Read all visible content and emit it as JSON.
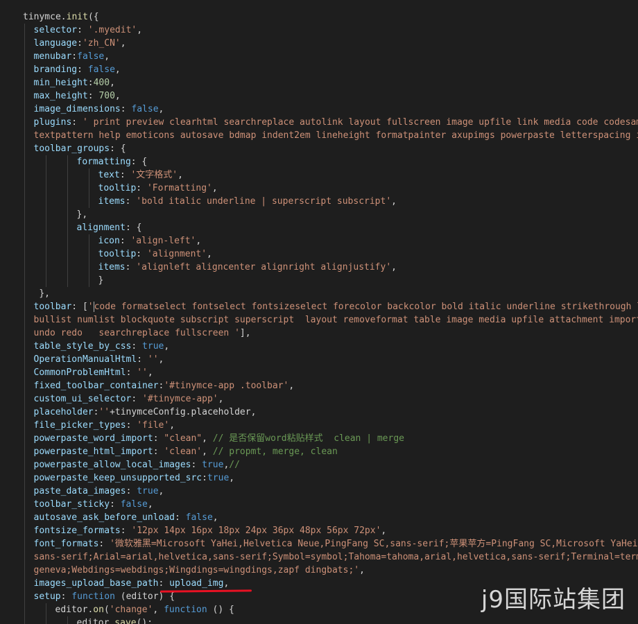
{
  "watermark": "j9国际站集团",
  "colors": {
    "background": "#1e1e1e",
    "property": "#9cdcfe",
    "string": "#ce9178",
    "number": "#b5cea8",
    "keyword": "#569cd6",
    "comment": "#6a9955",
    "function": "#dcdcaa",
    "punctuation": "#d4d4d4",
    "underline": "#e81123"
  },
  "code_lines": [
    {
      "indent": 0,
      "tokens": [
        [
          "w",
          "tinymce"
        ],
        [
          "p",
          "."
        ],
        [
          "f",
          "init"
        ],
        [
          "p",
          "({"
        ]
      ]
    },
    {
      "indent": 1,
      "tokens": [
        [
          "k",
          "selector"
        ],
        [
          "p",
          ": "
        ],
        [
          "s",
          "'.myedit'"
        ],
        [
          "p",
          ","
        ]
      ]
    },
    {
      "indent": 1,
      "tokens": [
        [
          "k",
          "language"
        ],
        [
          "p",
          ":"
        ],
        [
          "s",
          "'zh_CN'"
        ],
        [
          "p",
          ","
        ]
      ]
    },
    {
      "indent": 1,
      "tokens": [
        [
          "k",
          "menubar"
        ],
        [
          "p",
          ":"
        ],
        [
          "b",
          "false"
        ],
        [
          "p",
          ","
        ]
      ]
    },
    {
      "indent": 1,
      "tokens": [
        [
          "k",
          "branding"
        ],
        [
          "p",
          ": "
        ],
        [
          "b",
          "false"
        ],
        [
          "p",
          ","
        ]
      ]
    },
    {
      "indent": 1,
      "tokens": [
        [
          "k",
          "min_height"
        ],
        [
          "p",
          ":"
        ],
        [
          "n",
          "400"
        ],
        [
          "p",
          ","
        ]
      ]
    },
    {
      "indent": 1,
      "tokens": [
        [
          "k",
          "max_height"
        ],
        [
          "p",
          ": "
        ],
        [
          "n",
          "700"
        ],
        [
          "p",
          ","
        ]
      ]
    },
    {
      "indent": 1,
      "tokens": [
        [
          "k",
          "image_dimensions"
        ],
        [
          "p",
          ": "
        ],
        [
          "b",
          "false"
        ],
        [
          "p",
          ","
        ]
      ]
    },
    {
      "indent": 1,
      "tokens": [
        [
          "k",
          "plugins"
        ],
        [
          "p",
          ": "
        ],
        [
          "s",
          "' print preview clearhtml searchreplace autolink layout fullscreen image upfile link media code codesamp"
        ]
      ]
    },
    {
      "indent": 1,
      "tokens": [
        [
          "s",
          "textpattern help emoticons autosave bdmap indent2em lineheight formatpainter axupimgs powerpaste letterspacing ima"
        ]
      ]
    },
    {
      "indent": 1,
      "tokens": [
        [
          "k",
          "toolbar_groups"
        ],
        [
          "p",
          ": {"
        ]
      ]
    },
    {
      "indent": 5,
      "tokens": [
        [
          "k",
          "formatting"
        ],
        [
          "p",
          ": {"
        ]
      ]
    },
    {
      "indent": 7,
      "tokens": [
        [
          "k",
          "text"
        ],
        [
          "p",
          ": "
        ],
        [
          "s",
          "'文字格式'"
        ],
        [
          "p",
          ","
        ]
      ]
    },
    {
      "indent": 7,
      "tokens": [
        [
          "k",
          "tooltip"
        ],
        [
          "p",
          ": "
        ],
        [
          "s",
          "'Formatting'"
        ],
        [
          "p",
          ","
        ]
      ]
    },
    {
      "indent": 7,
      "tokens": [
        [
          "k",
          "items"
        ],
        [
          "p",
          ": "
        ],
        [
          "s",
          "'bold italic underline | superscript subscript'"
        ],
        [
          "p",
          ","
        ]
      ]
    },
    {
      "indent": 5,
      "tokens": [
        [
          "p",
          "},"
        ]
      ]
    },
    {
      "indent": 5,
      "tokens": [
        [
          "k",
          "alignment"
        ],
        [
          "p",
          ": {"
        ]
      ]
    },
    {
      "indent": 7,
      "tokens": [
        [
          "k",
          "icon"
        ],
        [
          "p",
          ": "
        ],
        [
          "s",
          "'align-left'"
        ],
        [
          "p",
          ","
        ]
      ]
    },
    {
      "indent": 7,
      "tokens": [
        [
          "k",
          "tooltip"
        ],
        [
          "p",
          ": "
        ],
        [
          "s",
          "'alignment'"
        ],
        [
          "p",
          ","
        ]
      ]
    },
    {
      "indent": 7,
      "tokens": [
        [
          "k",
          "items"
        ],
        [
          "p",
          ": "
        ],
        [
          "s",
          "'alignleft aligncenter alignright alignjustify'"
        ],
        [
          "p",
          ","
        ]
      ]
    },
    {
      "indent": 7,
      "tokens": [
        [
          "p",
          "}"
        ]
      ]
    },
    {
      "indent": 1,
      "tokens": [
        [
          "p",
          " },"
        ]
      ]
    },
    {
      "indent": 1,
      "tokens": [
        [
          "k",
          "toolbar"
        ],
        [
          "p",
          ": ["
        ],
        [
          "s",
          "'"
        ],
        [
          "cursor",
          ""
        ],
        [
          "s",
          "code formatselect fontselect fontsizeselect forecolor backcolor bold italic underline strikethrough l"
        ]
      ]
    },
    {
      "indent": 1,
      "tokens": [
        [
          "s",
          "bullist numlist blockquote subscript superscript  layout removeformat table image media upfile attachment importw"
        ]
      ]
    },
    {
      "indent": 1,
      "tokens": [
        [
          "s",
          "undo redo   searchreplace fullscreen '"
        ],
        [
          "p",
          "],"
        ]
      ]
    },
    {
      "indent": 1,
      "tokens": [
        [
          "k",
          "table_style_by_css"
        ],
        [
          "p",
          ": "
        ],
        [
          "b",
          "true"
        ],
        [
          "p",
          ","
        ]
      ]
    },
    {
      "indent": 1,
      "tokens": [
        [
          "k",
          "OperationManualHtml"
        ],
        [
          "p",
          ": "
        ],
        [
          "s",
          "''"
        ],
        [
          "p",
          ","
        ]
      ]
    },
    {
      "indent": 1,
      "tokens": [
        [
          "k",
          "CommonProblemHtml"
        ],
        [
          "p",
          ": "
        ],
        [
          "s",
          "''"
        ],
        [
          "p",
          ","
        ]
      ]
    },
    {
      "indent": 1,
      "tokens": [
        [
          "k",
          "fixed_toolbar_container"
        ],
        [
          "p",
          ":"
        ],
        [
          "s",
          "'#tinymce-app .toolbar'"
        ],
        [
          "p",
          ","
        ]
      ]
    },
    {
      "indent": 1,
      "tokens": [
        [
          "k",
          "custom_ui_selector"
        ],
        [
          "p",
          ": "
        ],
        [
          "s",
          "'#tinymce-app'"
        ],
        [
          "p",
          ","
        ]
      ]
    },
    {
      "indent": 1,
      "tokens": [
        [
          "k",
          "placeholder"
        ],
        [
          "p",
          ":"
        ],
        [
          "s",
          "''"
        ],
        [
          "p",
          "+tinymceConfig.placeholder,"
        ]
      ]
    },
    {
      "indent": 1,
      "tokens": [
        [
          "k",
          "file_picker_types"
        ],
        [
          "p",
          ": "
        ],
        [
          "s",
          "'file'"
        ],
        [
          "p",
          ","
        ]
      ]
    },
    {
      "indent": 1,
      "tokens": [
        [
          "k",
          "powerpaste_word_import"
        ],
        [
          "p",
          ": "
        ],
        [
          "s",
          "\"clean\""
        ],
        [
          "p",
          ", "
        ],
        [
          "c",
          "// 是否保留word粘贴样式  clean | merge"
        ]
      ]
    },
    {
      "indent": 1,
      "tokens": [
        [
          "k",
          "powerpaste_html_import"
        ],
        [
          "p",
          ": "
        ],
        [
          "s",
          "'clean'"
        ],
        [
          "p",
          ", "
        ],
        [
          "c",
          "// propmt, merge, clean"
        ]
      ]
    },
    {
      "indent": 1,
      "tokens": [
        [
          "k",
          "powerpaste_allow_local_images"
        ],
        [
          "p",
          ": "
        ],
        [
          "b",
          "true"
        ],
        [
          "p",
          ","
        ],
        [
          "c",
          "//"
        ]
      ]
    },
    {
      "indent": 1,
      "tokens": [
        [
          "k",
          "powerpaste_keep_unsupported_src"
        ],
        [
          "p",
          ":"
        ],
        [
          "b",
          "true"
        ],
        [
          "p",
          ","
        ]
      ]
    },
    {
      "indent": 1,
      "tokens": [
        [
          "k",
          "paste_data_images"
        ],
        [
          "p",
          ": "
        ],
        [
          "b",
          "true"
        ],
        [
          "p",
          ","
        ]
      ]
    },
    {
      "indent": 1,
      "tokens": [
        [
          "k",
          "toolbar_sticky"
        ],
        [
          "p",
          ": "
        ],
        [
          "b",
          "false"
        ],
        [
          "p",
          ","
        ]
      ]
    },
    {
      "indent": 1,
      "tokens": [
        [
          "k",
          "autosave_ask_before_unload"
        ],
        [
          "p",
          ": "
        ],
        [
          "b",
          "false"
        ],
        [
          "p",
          ","
        ]
      ]
    },
    {
      "indent": 1,
      "tokens": [
        [
          "k",
          "fontsize_formats"
        ],
        [
          "p",
          ": "
        ],
        [
          "s",
          "'12px 14px 16px 18px 24px 36px 48px 56px 72px'"
        ],
        [
          "p",
          ","
        ]
      ]
    },
    {
      "indent": 1,
      "tokens": [
        [
          "k",
          "font_formats"
        ],
        [
          "p",
          ": "
        ],
        [
          "s",
          "'微软雅黑=Microsoft YaHei,Helvetica Neue,PingFang SC,sans-serif;苹果苹方=PingFang SC,Microsoft YaHei,"
        ]
      ]
    },
    {
      "indent": 1,
      "tokens": [
        [
          "s",
          "sans-serif;Arial=arial,helvetica,sans-serif;Symbol=symbol;Tahoma=tahoma,arial,helvetica,sans-serif;Terminal=termi"
        ]
      ]
    },
    {
      "indent": 1,
      "tokens": [
        [
          "s",
          "geneva;Webdings=webdings;Wingdings=wingdings,zapf dingbats;'"
        ],
        [
          "p",
          ","
        ]
      ]
    },
    {
      "indent": 1,
      "tokens": [
        [
          "k",
          "images_upload_base_path"
        ],
        [
          "p",
          ": "
        ],
        [
          "k",
          "upload_img"
        ],
        [
          "p",
          ","
        ]
      ]
    },
    {
      "indent": 1,
      "tokens": [
        [
          "k",
          "setup"
        ],
        [
          "p",
          ": "
        ],
        [
          "b",
          "function"
        ],
        [
          "p",
          " (editor) {"
        ]
      ]
    },
    {
      "indent": 3,
      "tokens": [
        [
          "w",
          "editor"
        ],
        [
          "p",
          "."
        ],
        [
          "f",
          "on"
        ],
        [
          "p",
          "("
        ],
        [
          "s",
          "'change'"
        ],
        [
          "p",
          ", "
        ],
        [
          "b",
          "function"
        ],
        [
          "p",
          " () {"
        ]
      ]
    },
    {
      "indent": 5,
      "tokens": [
        [
          "w",
          "editor"
        ],
        [
          "p",
          "."
        ],
        [
          "f",
          "save"
        ],
        [
          "p",
          "();"
        ]
      ]
    }
  ]
}
